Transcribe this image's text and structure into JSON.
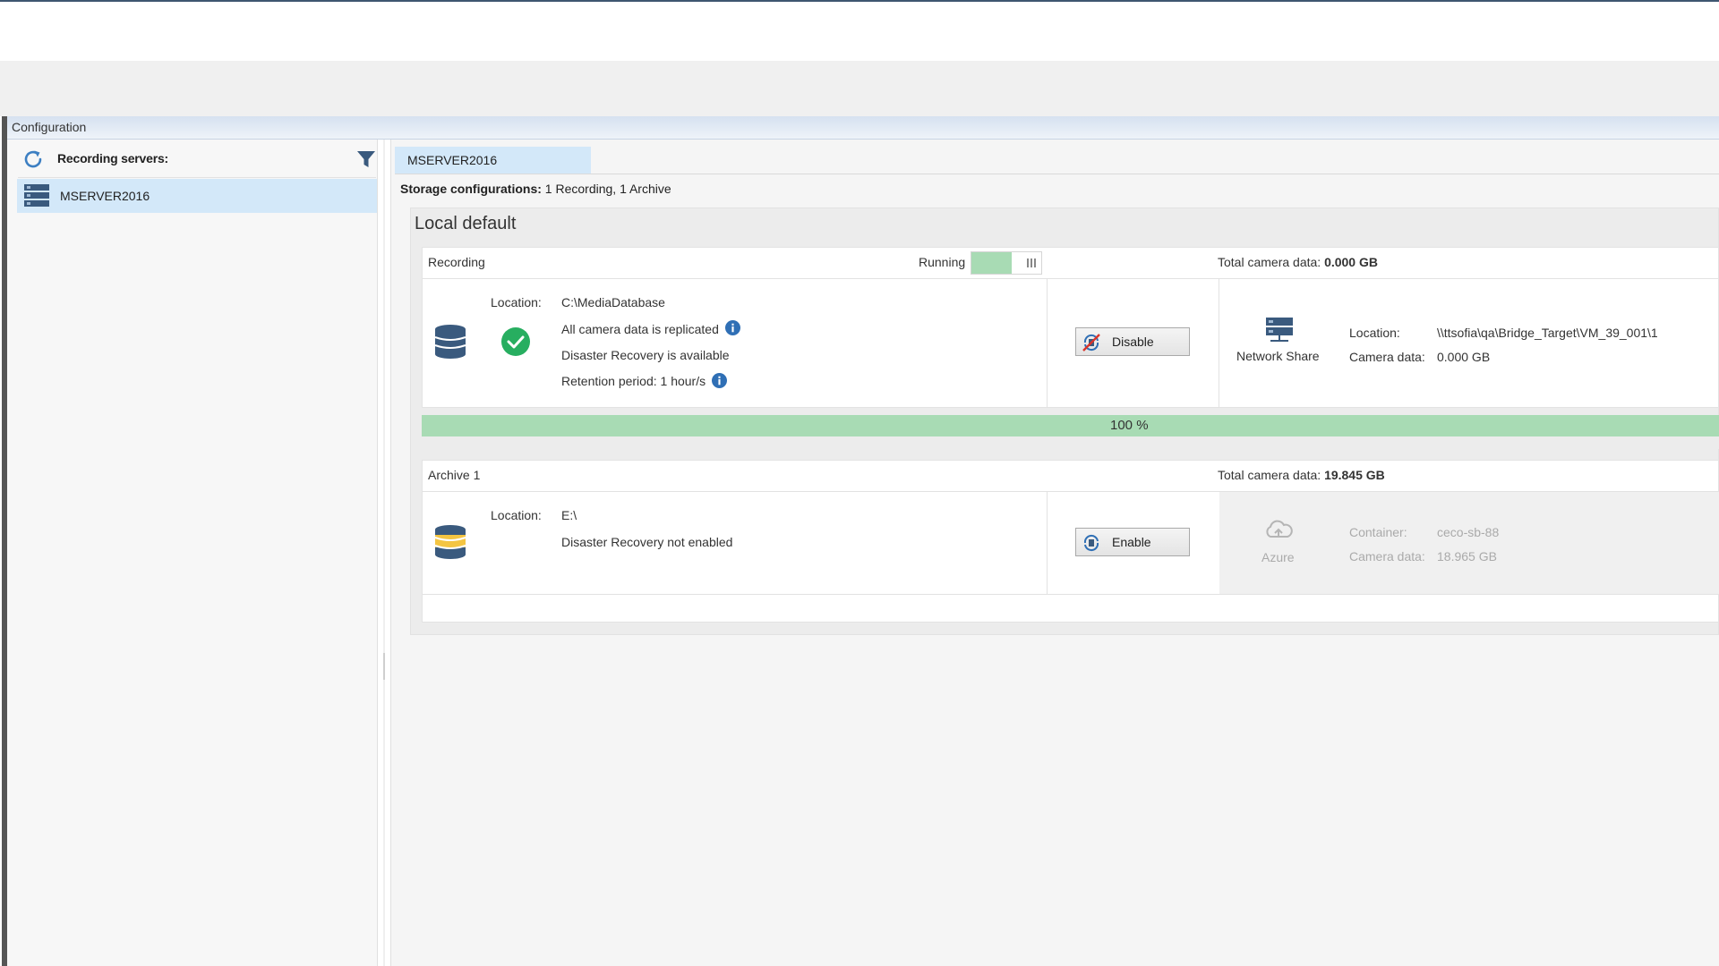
{
  "config_bar": {
    "title": "Configuration"
  },
  "left_pane": {
    "title": "Recording servers:",
    "servers": [
      {
        "label": "MSERVER2016"
      }
    ]
  },
  "tab": {
    "label": "MSERVER2016"
  },
  "storage": {
    "label": "Storage configurations:",
    "value": " 1 Recording, 1 Archive"
  },
  "local": {
    "title": "Local default",
    "recording": {
      "title": "Recording",
      "status_label": "Running",
      "total_label": "Total camera data: ",
      "total_value": "0.000 GB",
      "location_label": "Location:",
      "location_value": "C:\\MediaDatabase",
      "replicated_text": "All camera data is replicated",
      "dr_text": "Disaster Recovery is available",
      "retention_text": "Retention period: 1 hour/s",
      "button_label": "Disable",
      "target": {
        "type_label": "Network Share",
        "location_label": "Location:",
        "location_value": "\\\\ttsofia\\qa\\Bridge_Target\\VM_39_001\\1",
        "camera_label": "Camera data:",
        "camera_value": "0.000 GB"
      },
      "progress_text": "100 %",
      "progress_value": 100
    },
    "archive": {
      "title": "Archive 1",
      "total_label": "Total camera data: ",
      "total_value": "19.845 GB",
      "location_label": "Location:",
      "location_value": "E:\\",
      "dr_text": "Disaster Recovery not enabled",
      "button_label": "Enable",
      "target": {
        "type_label": "Azure",
        "container_label": "Container:",
        "container_value": "ceco-sb-88",
        "camera_label": "Camera data:",
        "camera_value": "18.965 GB"
      }
    }
  },
  "colors": {
    "selection": "#d3e8f9",
    "progress": "#a8dbb4",
    "ok_green": "#27ae60",
    "info_blue": "#2f6fb5",
    "db_blue": "#3a5a7e",
    "db_yellow": "#f4c542"
  },
  "icons": [
    "refresh-icon",
    "filter-icon",
    "server-icon",
    "database-icon",
    "check-circle-icon",
    "info-icon",
    "disable-replication-icon",
    "network-share-icon",
    "archive-database-icon",
    "enable-replication-icon",
    "azure-cloud-icon"
  ]
}
